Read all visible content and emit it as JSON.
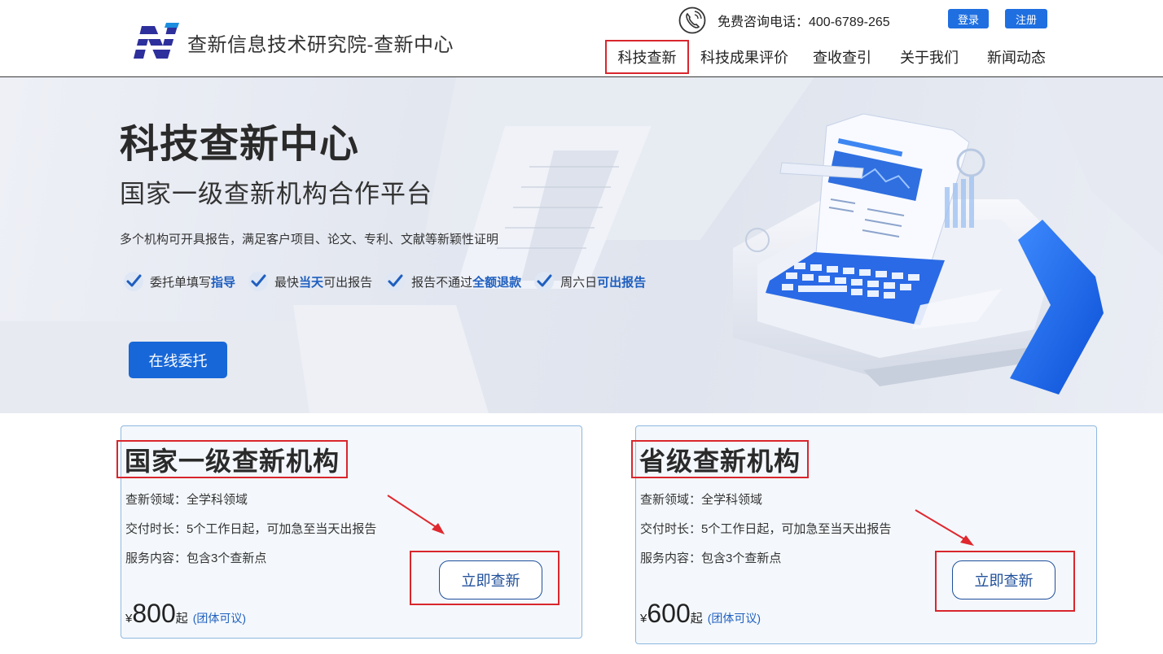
{
  "header": {
    "logo_text": "查新信息技术研究院-查新中心",
    "phone_label": "免费咨询电话：400-6789-265",
    "login_label": "登录",
    "register_label": "注册"
  },
  "nav": {
    "items": [
      {
        "label": "科技查新"
      },
      {
        "label": "科技成果评价"
      },
      {
        "label": "查收查引"
      },
      {
        "label": "关于我们"
      },
      {
        "label": "新闻动态"
      }
    ],
    "active": "科技查新"
  },
  "hero": {
    "title": "科技查新中心",
    "subtitle": "国家一级查新机构合作平台",
    "description": "多个机构可开具报告，满足客户项目、论文、专利、文献等新颖性证明",
    "features": [
      {
        "prefix": "委托单填写",
        "emphasis": "指导",
        "suffix": ""
      },
      {
        "prefix": "最快",
        "emphasis": "当天",
        "suffix": "可出报告"
      },
      {
        "prefix": "报告不通过",
        "emphasis": "全额退款",
        "suffix": ""
      },
      {
        "prefix": "周六日",
        "emphasis": "可出报告",
        "suffix": ""
      }
    ],
    "cta_label": "在线委托"
  },
  "cards": [
    {
      "title": "国家一级查新机构",
      "field": "查新领域：全学科领域",
      "delivery": "交付时长：5个工作日起，可加急至当天出报告",
      "content": "服务内容：包含3个查新点",
      "currency": "¥",
      "price": "800",
      "price_unit": "起",
      "price_note": "(团体可议)",
      "button_label": "立即查新"
    },
    {
      "title": "省级查新机构",
      "field": "查新领域：全学科领域",
      "delivery": "交付时长：5个工作日起，可加急至当天出报告",
      "content": "服务内容：包含3个查新点",
      "currency": "¥",
      "price": "600",
      "price_unit": "起",
      "price_note": "(团体可议)",
      "button_label": "立即查新"
    }
  ],
  "colors": {
    "primary": "#1767d8",
    "highlight_box": "#d9262d",
    "emphasis_text": "#1f5fbf",
    "card_border": "#8fb8e0"
  },
  "icons": {
    "logo": "n-logo-icon",
    "phone": "phone-icon",
    "feature_check": "check-icon"
  }
}
